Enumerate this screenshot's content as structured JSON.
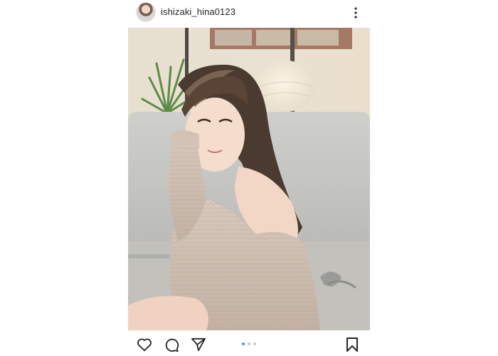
{
  "post": {
    "username": "ishizaki_hina0123",
    "carousel": {
      "count": 3,
      "active_index": 0
    }
  },
  "icons": {
    "avatar": "profile-avatar",
    "more": "vertical-ellipsis-icon",
    "like": "heart-icon",
    "comment": "comment-bubble-icon",
    "share": "paper-plane-icon",
    "save": "bookmark-icon"
  },
  "colors": {
    "text": "#262626",
    "active_dot": "#3897f0",
    "inactive_dot": "#c8c8c8"
  }
}
